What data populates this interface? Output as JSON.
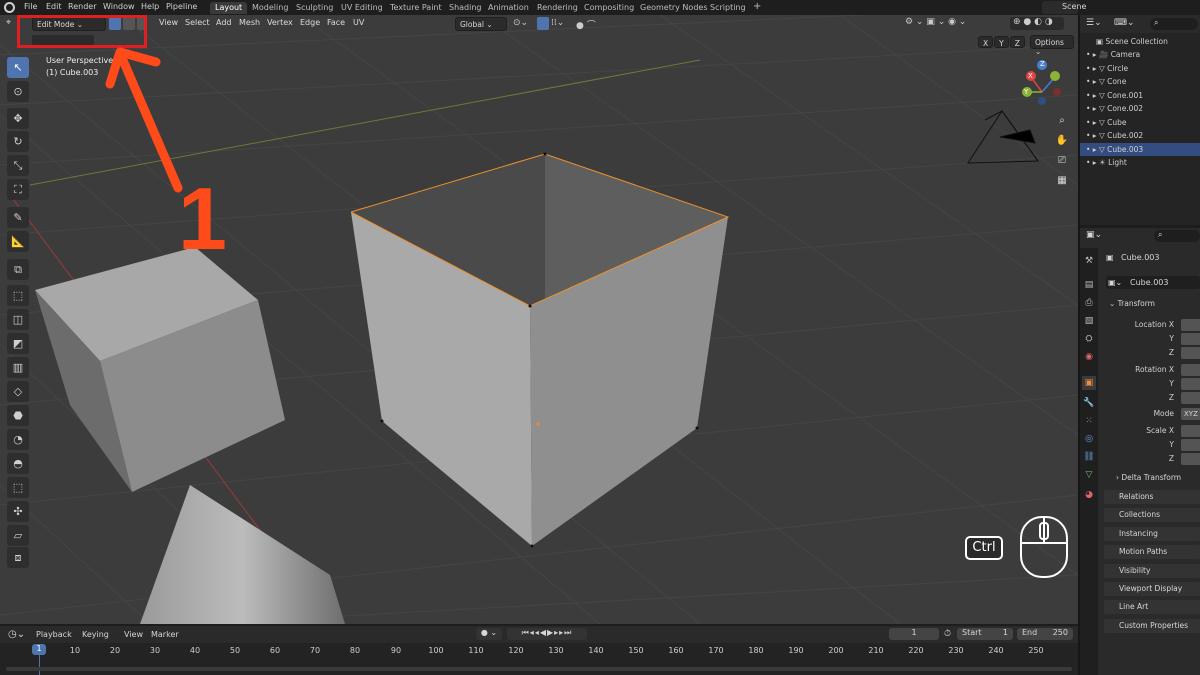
{
  "topbar": {
    "menus": [
      "File",
      "Edit",
      "Render",
      "Window",
      "Help",
      "Pipeline"
    ],
    "workspaces": [
      "Layout",
      "Modeling",
      "Sculpting",
      "UV Editing",
      "Texture Paint",
      "Shading",
      "Animation",
      "Rendering",
      "Compositing",
      "Geometry Nodes",
      "Scripting"
    ],
    "add_ws": "+",
    "scene": "Scene"
  },
  "viewport": {
    "mode": "Edit Mode",
    "menus": [
      "View",
      "Select",
      "Add",
      "Mesh",
      "Vertex",
      "Edge",
      "Face",
      "UV"
    ],
    "orientation": "Global",
    "options": "Options",
    "axes": [
      "X",
      "Y",
      "Z"
    ],
    "perspective": "User Perspective",
    "object": "(1) Cube.003",
    "annotation_number": "1",
    "ctrl_key": "Ctrl",
    "gizmo_x": "X",
    "gizmo_y": "Y",
    "gizmo_z": "Z"
  },
  "outliner": {
    "root": "Scene Collection",
    "items": [
      "Camera",
      "Circle",
      "Cone",
      "Cone.001",
      "Cone.002",
      "Cube",
      "Cube.002",
      "Cube.003",
      "Light"
    ],
    "selected": "Cube.003"
  },
  "properties": {
    "object_name": "Cube.003",
    "data_name": "Cube.003",
    "transform": "Transform",
    "location": "Location X",
    "rotation": "Rotation X",
    "scale": "Scale X",
    "y": "Y",
    "z": "Z",
    "mode_label": "Mode",
    "mode_value": "XYZ",
    "delta": "Delta Transform",
    "sections": [
      "Relations",
      "Collections",
      "Instancing",
      "Motion Paths",
      "Visibility",
      "Viewport Display",
      "Line Art",
      "Custom Properties"
    ]
  },
  "timeline": {
    "menus": [
      "Playback",
      "Keying",
      "View",
      "Marker"
    ],
    "current_frame": "1",
    "start_label": "Start",
    "start": "1",
    "end_label": "End",
    "end": "250",
    "frames": [
      "1",
      "10",
      "20",
      "30",
      "40",
      "50",
      "60",
      "70",
      "80",
      "90",
      "100",
      "110",
      "120",
      "130",
      "140",
      "150",
      "160",
      "170",
      "180",
      "190",
      "200",
      "210",
      "220",
      "230",
      "240",
      "250"
    ]
  },
  "colors": {
    "accent": "#4f75b0",
    "highlight_box": "#e02020",
    "arrow": "#ff4a1a",
    "selection_edge": "#f0902a"
  }
}
